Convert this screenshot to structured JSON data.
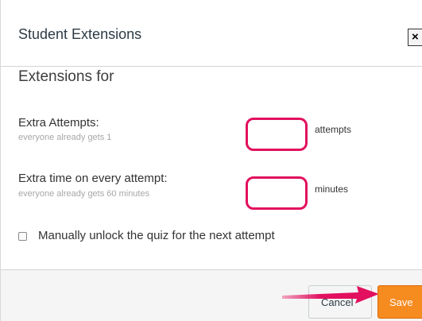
{
  "dialog": {
    "title": "Student Extensions",
    "close_label": "×"
  },
  "section": {
    "title": "Extensions for"
  },
  "extra_attempts": {
    "label": "Extra Attempts:",
    "hint": "everyone already gets 1",
    "value": "",
    "unit": "attempts"
  },
  "extra_time": {
    "label": "Extra time on every attempt:",
    "hint": "everyone already gets 60 minutes",
    "value": "",
    "unit": "minutes"
  },
  "unlock": {
    "label": "Manually unlock the quiz for the next attempt",
    "checked": false
  },
  "footer": {
    "cancel_label": "Cancel",
    "save_label": "Save"
  },
  "colors": {
    "highlight": "#e2105e",
    "save": "#f68b1f"
  }
}
